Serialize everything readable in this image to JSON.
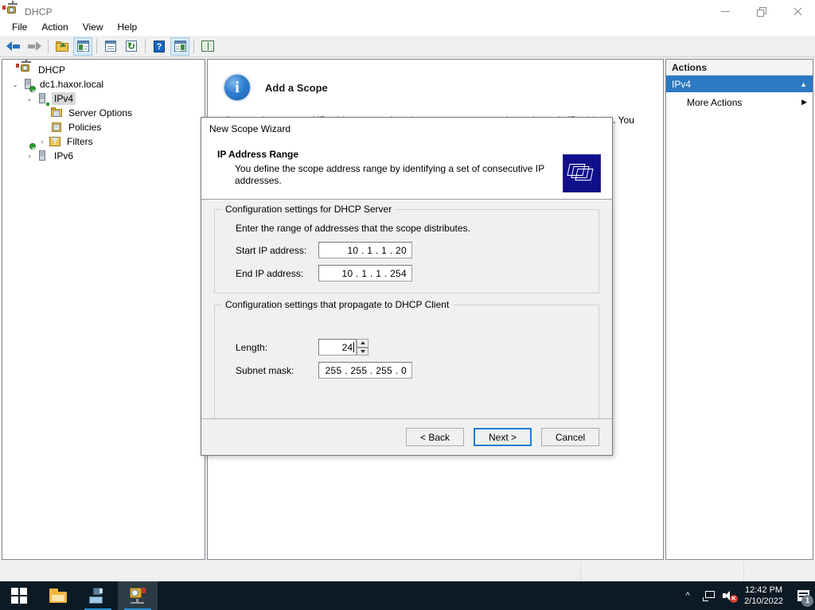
{
  "window": {
    "title": "DHCP",
    "icon": "dhcp-icon",
    "controls": {
      "minimize": "minimize",
      "restore": "restore",
      "close": "close"
    }
  },
  "menubar": {
    "items": [
      "File",
      "Action",
      "View",
      "Help"
    ]
  },
  "toolbar": {
    "buttons": [
      {
        "name": "back-icon",
        "pressed": false
      },
      {
        "name": "forward-icon",
        "pressed": false
      },
      {
        "name": "up-one-level-icon",
        "pressed": false
      },
      {
        "name": "show-hide-console-tree-icon",
        "pressed": true
      },
      {
        "name": "properties-icon",
        "pressed": false
      },
      {
        "name": "refresh-icon",
        "pressed": false
      },
      {
        "name": "help-icon",
        "pressed": false
      },
      {
        "name": "export-list-icon",
        "pressed": true
      },
      {
        "name": "show-help-topics-icon",
        "pressed": false
      }
    ]
  },
  "tree": {
    "nodes": [
      {
        "label": "DHCP",
        "icon": "dhcp-icon",
        "indent": 0,
        "twist": "",
        "selected": false
      },
      {
        "label": "dc1.haxor.local",
        "icon": "server-icon",
        "indent": 1,
        "twist": "expanded",
        "selected": false
      },
      {
        "label": "IPv4",
        "icon": "ipv4-icon",
        "indent": 2,
        "twist": "expanded",
        "selected": true
      },
      {
        "label": "Server Options",
        "icon": "server-options-icon",
        "indent": 4,
        "twist": "",
        "selected": false
      },
      {
        "label": "Policies",
        "icon": "policies-icon",
        "indent": 4,
        "twist": "",
        "selected": false
      },
      {
        "label": "Filters",
        "icon": "filters-icon",
        "indent": 3,
        "twist": "collapsed",
        "selected": false
      },
      {
        "label": "IPv6",
        "icon": "ipv6-icon",
        "indent": 2,
        "twist": "collapsed",
        "selected": false
      }
    ]
  },
  "center": {
    "title": "Add a Scope",
    "icon": "info-icon",
    "body_text": "A scope is a range of IP addresses assigned to computers requesting a dynamic IP address. You"
  },
  "actions": {
    "header": "Actions",
    "group_label": "IPv4",
    "group_chevron": "chevron-up-icon",
    "items": [
      {
        "label": "More Actions",
        "chevron": "chevron-right-icon"
      }
    ]
  },
  "dialog": {
    "titlebar": "New Scope Wizard",
    "heading": "IP Address Range",
    "subheading": "You define the scope address range by identifying a set of consecutive IP addresses.",
    "header_icon": "folder-stack-icon",
    "server_group": {
      "legend": "Configuration settings for DHCP Server",
      "intro": "Enter the range of addresses that the scope distributes.",
      "start_label": "Start IP address:",
      "start_value": "10 .   1  .   1  .  20",
      "end_label": "End IP address:",
      "end_value": "10 .   1  .   1  . 254"
    },
    "client_group": {
      "legend": "Configuration settings that propagate to DHCP Client",
      "length_label": "Length:",
      "length_value": "24",
      "mask_label": "Subnet mask:",
      "mask_value": "255 . 255 . 255 .   0"
    },
    "buttons": {
      "back": "< Back",
      "next": "Next >",
      "cancel": "Cancel"
    }
  },
  "taskbar": {
    "start": "start-icon",
    "apps": [
      {
        "name": "file-explorer",
        "active": false
      },
      {
        "name": "server-manager",
        "active": false
      },
      {
        "name": "dhcp",
        "active": true
      }
    ],
    "tray": {
      "overflow": "chevron-up-icon",
      "network": "network-icon",
      "volume": "volume-muted-icon",
      "time": "12:42 PM",
      "date": "2/10/2022",
      "notifications_count": "1"
    }
  },
  "colors": {
    "accent": "#2b79c2",
    "focus_border": "#1a7fd4",
    "taskbar_bg": "#0b1a24",
    "dialog_bg": "#f0f0f0"
  }
}
